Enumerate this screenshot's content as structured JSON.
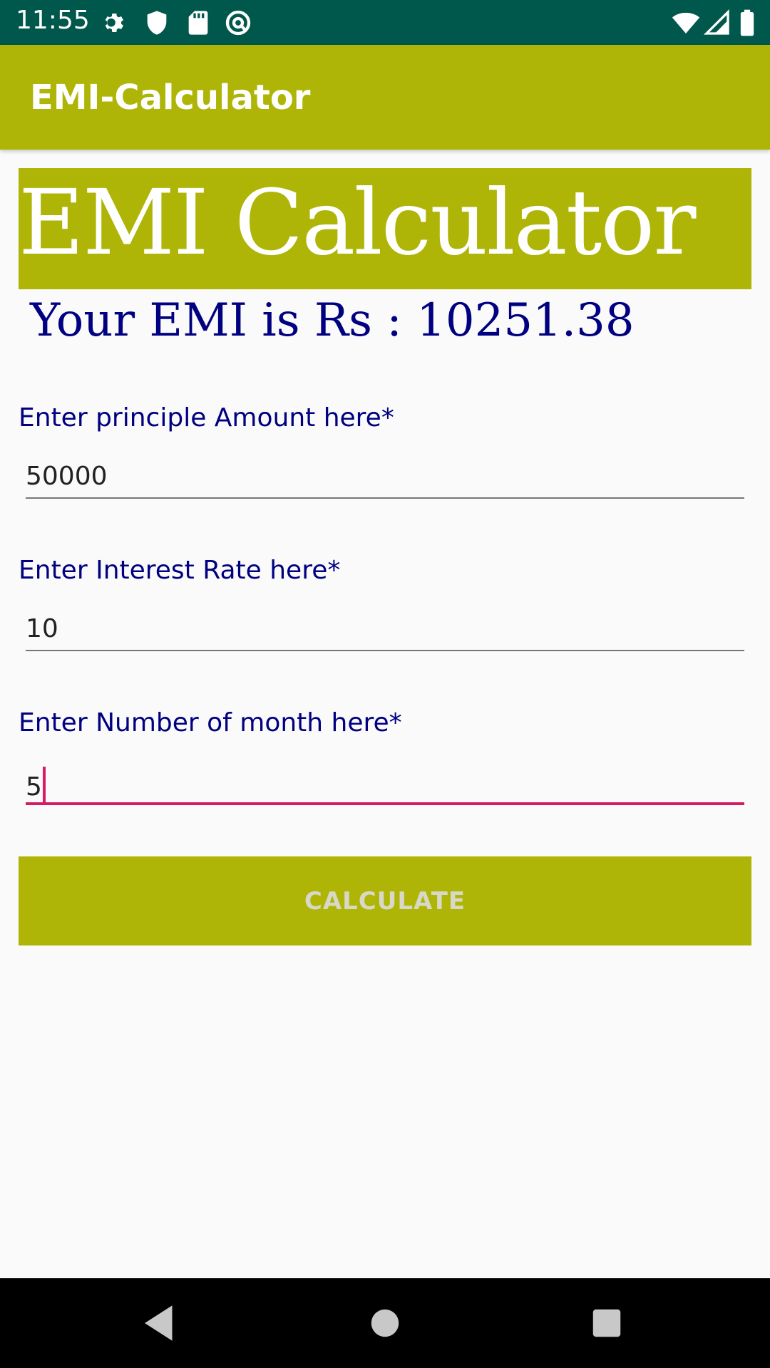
{
  "status_bar": {
    "time": "11:55",
    "background": "#00574b",
    "left_icons": [
      "gear-icon",
      "shield-icon",
      "sd-card-icon",
      "at-sign-icon"
    ],
    "right_icons": [
      "wifi-icon",
      "signal-icon",
      "battery-icon"
    ]
  },
  "app_bar": {
    "title": "EMI-Calculator",
    "color": "#aeb506"
  },
  "banner": {
    "text": "EMI Calculator"
  },
  "result": {
    "text": "Your EMI is Rs : 10251.38"
  },
  "fields": [
    {
      "label": "Enter principle Amount here*",
      "value": "50000"
    },
    {
      "label": "Enter Interest Rate here*",
      "value": "10"
    },
    {
      "label": "Enter Number of month here*",
      "value": "5"
    }
  ],
  "button": {
    "label": "CALCULATE"
  },
  "nav_bar": {
    "icons": [
      "back-icon",
      "home-icon",
      "recents-icon"
    ]
  },
  "colors": {
    "accent": "#aeb506",
    "status_bar": "#00574b",
    "label_text": "#000080",
    "focus_underline": "#d81b60"
  }
}
